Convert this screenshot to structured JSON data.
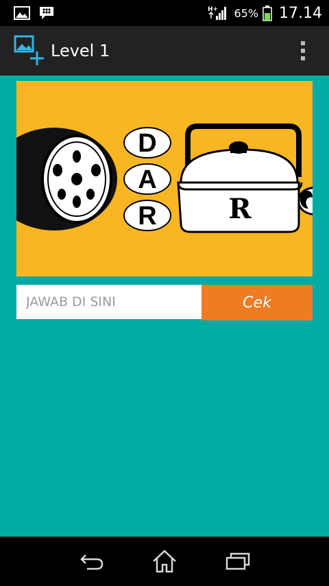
{
  "status_bar": {
    "network_label": "H+",
    "battery_percent": "65%",
    "battery_level": 0.65,
    "time": "17.14",
    "icons": [
      "gallery-notification-icon",
      "bbm-notification-icon",
      "signal-icon",
      "battery-icon"
    ]
  },
  "action_bar": {
    "title": "Level 1",
    "app_icon": "add-image-icon",
    "overflow_icon": "overflow-menu-icon"
  },
  "puzzle": {
    "letters": [
      "D",
      "A",
      "R"
    ],
    "kettle_letter": "R",
    "colors": {
      "background": "#f9b623"
    }
  },
  "answer": {
    "placeholder": "JAWAB DI SINI",
    "value": "",
    "button_label": "Cek"
  },
  "nav_bar": {
    "icons": [
      "back-icon",
      "home-icon",
      "recent-apps-icon"
    ]
  },
  "colors": {
    "accent": "#ef7b22",
    "content_bg": "#00aba4",
    "actionbar_bg": "#222222"
  }
}
